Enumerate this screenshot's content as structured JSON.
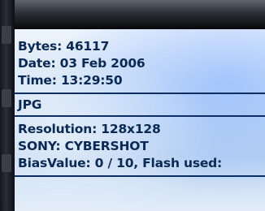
{
  "details": {
    "bytes": "Bytes: 46117",
    "date": "Date: 03 Feb 2006",
    "time": "Time: 13:29:50",
    "format": "JPG",
    "resolution": "Resolution: 128x128",
    "camera": "SONY: CYBERSHOT",
    "bias_flash": "BiasValue:  0 / 10, Flash used:"
  },
  "colors": {
    "text": "#0a2a55",
    "separator": "#0d2e63",
    "panel_top": "#eef4fb",
    "panel_mid": "#b9d2f0",
    "frame_dark": "#07080a"
  }
}
